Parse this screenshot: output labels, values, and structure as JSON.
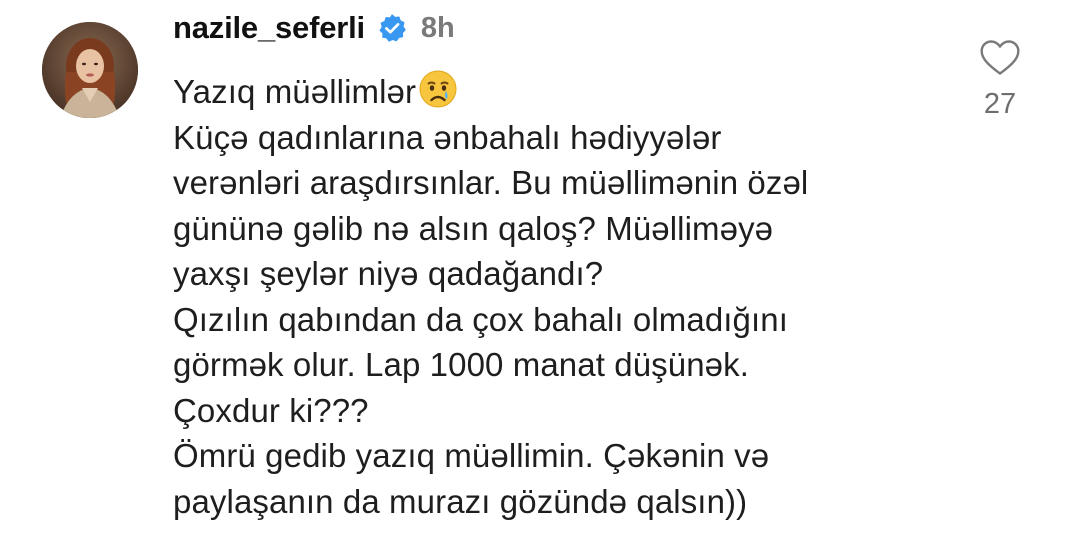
{
  "comment": {
    "username": "nazile_seferli",
    "verified": true,
    "timestamp": "8h",
    "like_count": "27",
    "avatar_icon": "profile-photo",
    "verified_badge_color": "#3897f0",
    "lines": [
      "Yazıq müəllimlər",
      "Küçə qadınlarına ənbahalı hədiyyələr",
      "verənləri araşdırsınlar. Bu müəllimənin özəl",
      "gününə gəlib nə alsın qaloş? Müəlliməyə",
      "yaxşı şeylər niyə qadağandı?",
      "Qızılın qabından da çox bahalı olmadığını",
      "görmək olur. Lap 1000 manat düşünək.",
      "Çoxdur ki???",
      "Ömrü gedib yazıq müəllimin. Çəkənin və",
      "paylaşanın da murazı gözündə qalsın))"
    ],
    "emoji": "crying-face-emoji"
  }
}
